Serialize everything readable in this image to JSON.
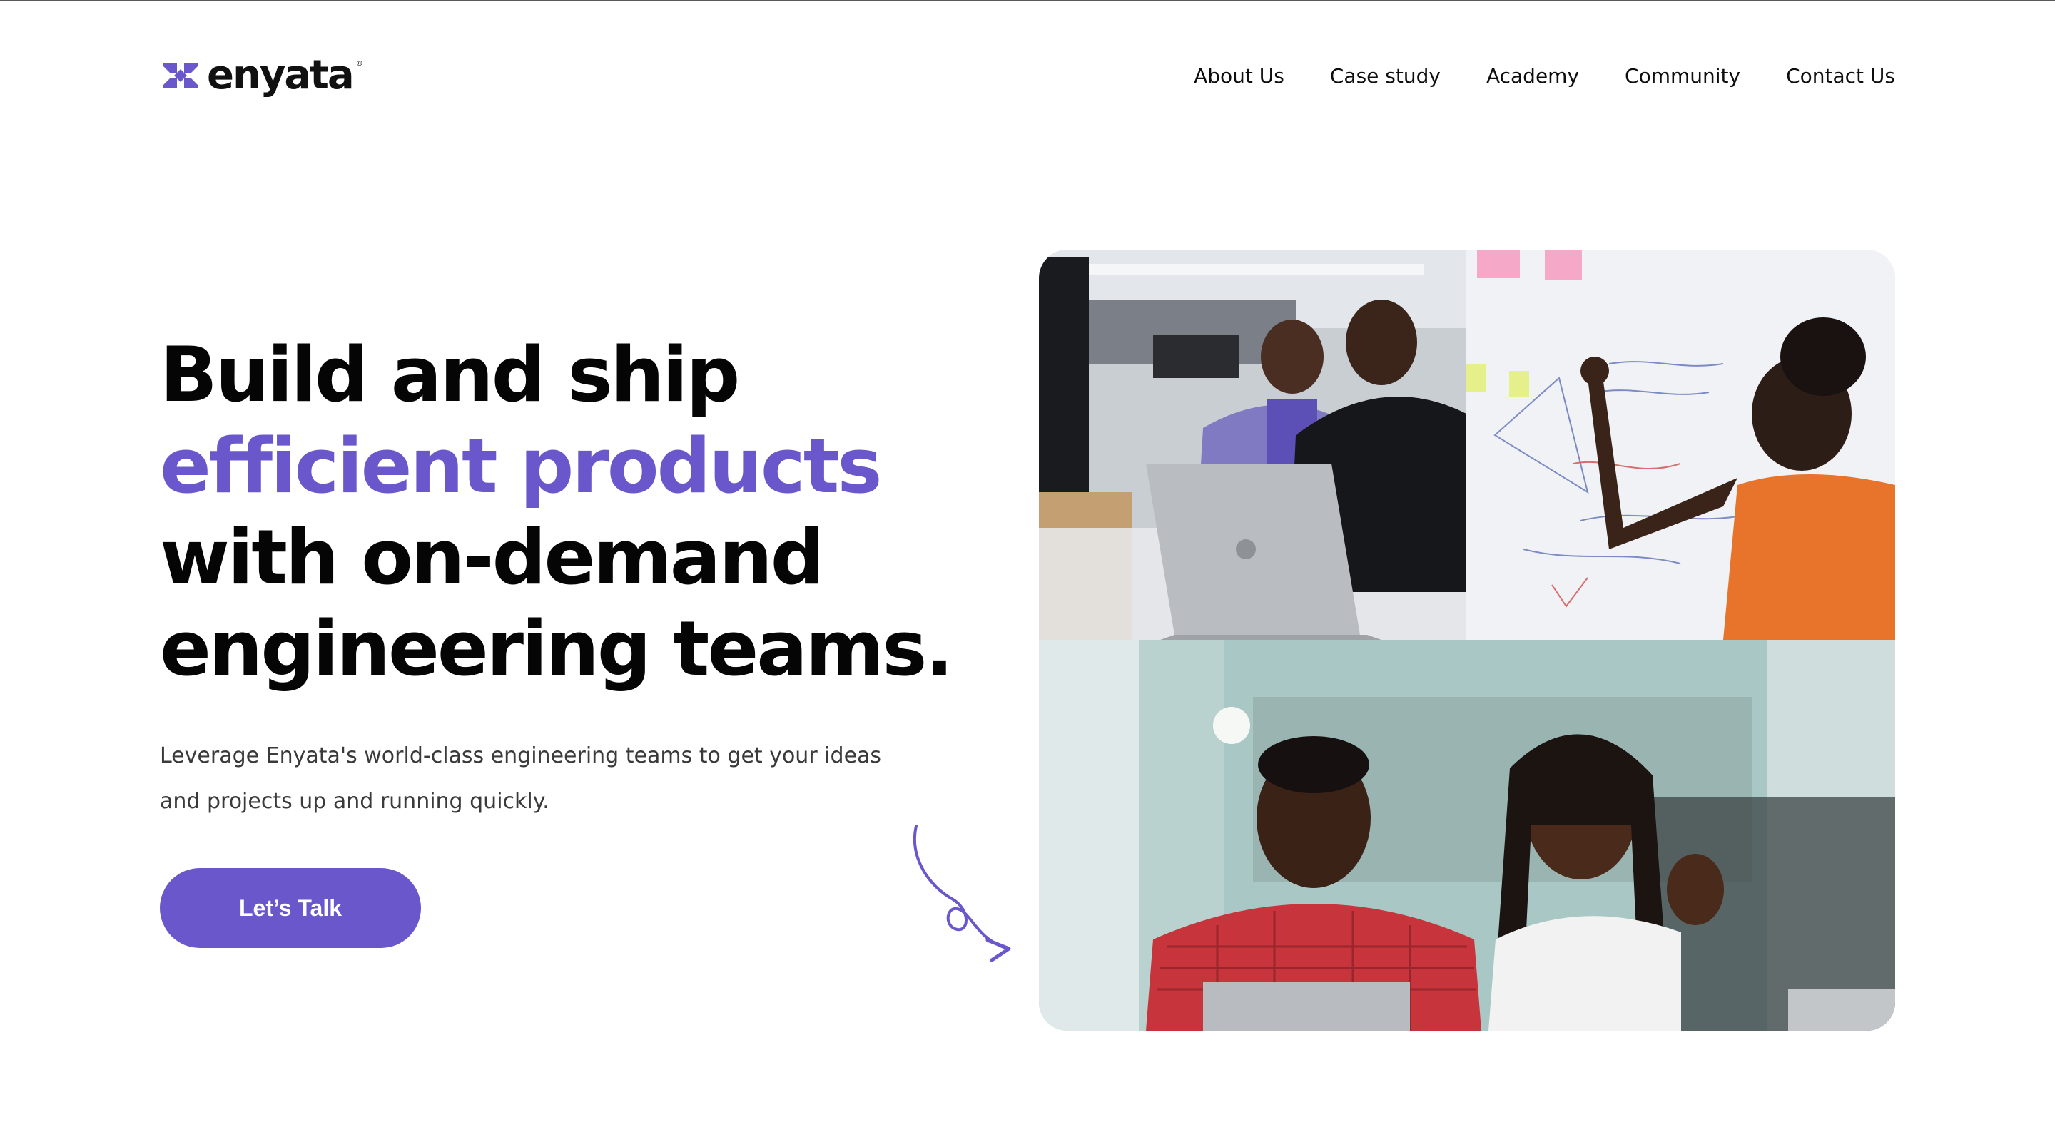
{
  "brand": {
    "name": "enyata",
    "trademark": "®",
    "accent_color": "#6b57cc"
  },
  "nav": {
    "items": [
      {
        "label": "About Us"
      },
      {
        "label": "Case study"
      },
      {
        "label": "Academy"
      },
      {
        "label": "Community"
      },
      {
        "label": "Contact Us"
      }
    ]
  },
  "hero": {
    "title_line1": "Build and ship",
    "title_line2_accent": "efficient products",
    "title_line3": "with on-demand",
    "title_line4": "engineering teams.",
    "subtitle_line1": "Leverage Enyata's world-class engineering teams to get your ideas",
    "subtitle_line2": "and projects up and running quickly.",
    "cta_label": "Let’s Talk"
  },
  "icons": {
    "logo": "enyata-logo-mark",
    "doodle": "curly-arrow-icon"
  },
  "images": [
    {
      "name": "engineers-at-laptops-photo"
    },
    {
      "name": "woman-writing-on-whiteboard-photo"
    },
    {
      "name": "two-colleagues-laughing-photo"
    }
  ]
}
